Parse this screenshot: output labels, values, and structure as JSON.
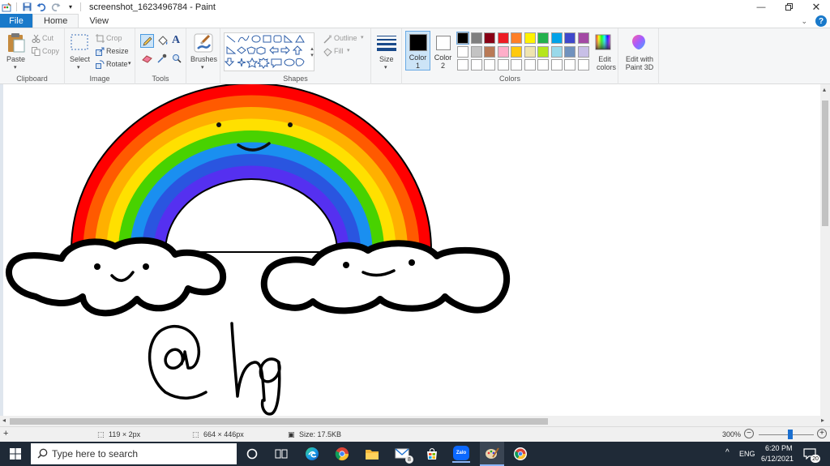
{
  "titlebar": {
    "title": "screenshot_1623496784 - Paint",
    "controls": [
      "minimize",
      "restore",
      "close"
    ]
  },
  "tabs": [
    {
      "label": "File"
    },
    {
      "label": "Home"
    },
    {
      "label": "View"
    }
  ],
  "ribbon": {
    "clipboard": {
      "paste": "Paste",
      "cut": "Cut",
      "copy": "Copy",
      "group": "Clipboard"
    },
    "image": {
      "select": "Select",
      "crop": "Crop",
      "resize": "Resize",
      "rotate": "Rotate",
      "group": "Image"
    },
    "tools": {
      "group": "Tools"
    },
    "brushes": {
      "label": "Brushes"
    },
    "shapes": {
      "outline": "Outline",
      "fill": "Fill",
      "group": "Shapes"
    },
    "size": {
      "label": "Size"
    },
    "colors": {
      "color1": "Color 1",
      "color2": "Color 2",
      "edit": "Edit colors",
      "group": "Colors",
      "color1_value": "#000000",
      "color2_value": "#ffffff",
      "palette_row1": [
        "#000000",
        "#7f7f7f",
        "#880015",
        "#ed1c24",
        "#ff7f27",
        "#fff200",
        "#22b14c",
        "#00a2e8",
        "#3f48cc",
        "#a349a4"
      ],
      "palette_row2": [
        "#ffffff",
        "#c3c3c3",
        "#b97a57",
        "#ffaec9",
        "#ffc90e",
        "#efe4b0",
        "#b5e61d",
        "#99d9ea",
        "#7092be",
        "#c8bfe7"
      ]
    },
    "paint3d": {
      "label": "Edit with Paint 3D"
    }
  },
  "canvas": {
    "rainbow_colors": [
      "#ff0000",
      "#ff5a00",
      "#ffb000",
      "#ffe000",
      "#48d200",
      "#1a8ff0",
      "#2a55e0",
      "#5530f0"
    ],
    "signature": "@hq"
  },
  "status": {
    "cursor": "119 × 2px",
    "selection": "664 × 446px",
    "size": "Size: 17.5KB",
    "zoom": "300%"
  },
  "taskbar": {
    "search_placeholder": "Type here to search",
    "lang": "ENG",
    "time": "6:20 PM",
    "date": "6/12/2021",
    "notifications": "20",
    "mail_badge": "8",
    "zalo": "Zalo"
  }
}
